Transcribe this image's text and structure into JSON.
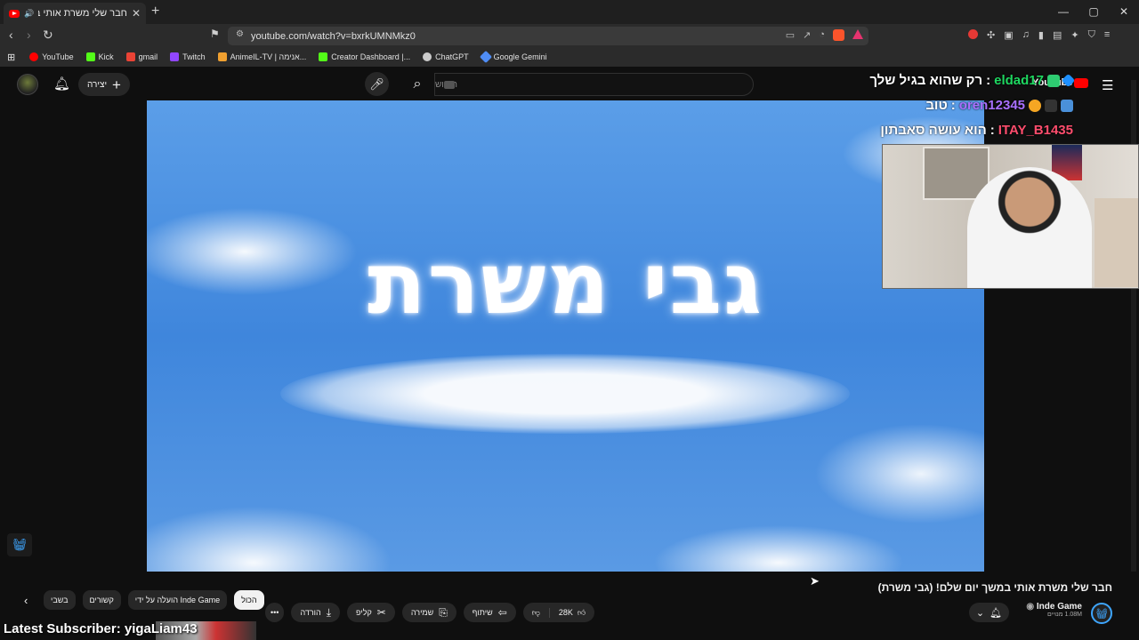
{
  "browser": {
    "tab_title": "חבר שלי משרת אותי במשך יו",
    "url": "youtube.com/watch?v=bxrkUMNMkz0",
    "window_controls": [
      "—",
      "▢",
      "✕"
    ]
  },
  "bookmarks": [
    {
      "label": "YouTube",
      "color": "#ff0000"
    },
    {
      "label": "Kick",
      "color": "#53fc18"
    },
    {
      "label": "gmail",
      "color": "#ea4335"
    },
    {
      "label": "Twitch",
      "color": "#9146ff"
    },
    {
      "label": "AnimeIL-TV | אנימה...",
      "color": "#f0a030"
    },
    {
      "label": "Creator Dashboard |...",
      "color": "#53fc18"
    },
    {
      "label": "ChatGPT",
      "color": "#cccccc"
    },
    {
      "label": "Google Gemini",
      "color": "#4f8df5"
    }
  ],
  "youtube": {
    "logo": "YouTube",
    "create_label": "יצירה",
    "search_placeholder": "חיפוש"
  },
  "video": {
    "overlay_text": "גבי משרת",
    "title": "חבר שלי משרת אותי במשך יום שלם! (גבי משרת)",
    "channel": "Inde Game",
    "subscribers": "1.08M מנויים",
    "likes": "28K"
  },
  "actions": {
    "share": "שיתוף",
    "save": "שמירה",
    "clip": "קליפ",
    "download": "הורדה"
  },
  "chips": [
    "הכול",
    "הועלה על ידי Inde Game",
    "קשורים",
    "בשבי"
  ],
  "chat": [
    {
      "user": "eldad17",
      "message": "רק שהוא בגיל שלך",
      "user_color": "#1ed760"
    },
    {
      "user": "oren12345",
      "message": "טוב",
      "user_color": "#a970ff"
    },
    {
      "user": "ITAY_B1435",
      "message": "הוא עושה סאבתון",
      "user_color": "#ff4d6d"
    }
  ],
  "overlay": {
    "latest_subscriber": "Latest Subscriber: yigaLiam43"
  }
}
